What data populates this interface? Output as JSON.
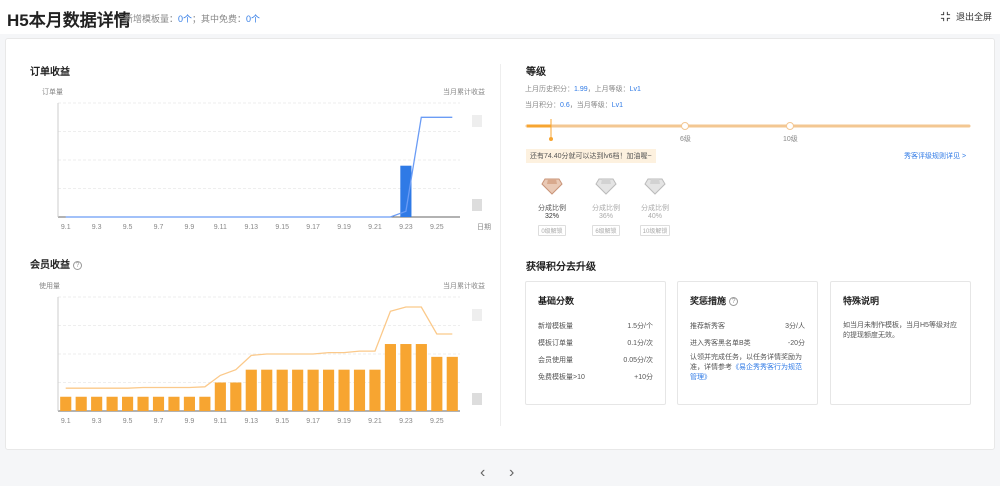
{
  "header": {
    "title": "H5本月数据详情",
    "new_templates_label": "新增模板量：",
    "new_templates_value": "0个",
    "free_label": "；其中免费：",
    "free_value": "0个",
    "exit_fullscreen": "退出全屏"
  },
  "order_revenue": {
    "title": "订单收益",
    "left_axis_label": "订单量",
    "right_axis_label": "当月累计收益",
    "x_axis_label": "日期"
  },
  "member_revenue": {
    "title": "会员收益",
    "left_axis_label": "使用量",
    "right_axis_label": "当月累计收益"
  },
  "level": {
    "title": "等级",
    "last_month_points_label": "上月历史积分：",
    "last_month_points_value": "1.99",
    "last_month_level_label": "，上月等级：",
    "last_month_level_value": "Lv1",
    "current_points_label": "当月积分：",
    "current_points_value": "0.6",
    "current_level_label": "，当月等级：",
    "current_level_value": "Lv1",
    "marker_6": "6级",
    "marker_10": "10级",
    "hint": "还有74.40分就可以达到lv6档！加油喔~",
    "rules_link": "秀客评级规则详见 >",
    "current_progress": 0.6,
    "tiers": [
      {
        "label": "分成比例",
        "pct": "32%",
        "badge": "0级解锁",
        "active": true
      },
      {
        "label": "分成比例",
        "pct": "36%",
        "badge": "6级解锁",
        "active": false
      },
      {
        "label": "分成比例",
        "pct": "40%",
        "badge": "10级解锁",
        "active": false
      }
    ]
  },
  "upgrade": {
    "title": "获得积分去升级",
    "basic": {
      "title": "基础分数",
      "rows": [
        {
          "k": "新增模板量",
          "v": "1.5分/个"
        },
        {
          "k": "模板订单量",
          "v": "0.1分/次"
        },
        {
          "k": "会员使用量",
          "v": "0.05分/次"
        },
        {
          "k": "免费模板量>10",
          "v": "+10分"
        }
      ]
    },
    "reward": {
      "title": "奖惩措施",
      "rows": [
        {
          "k": "推荐新秀客",
          "v": "3分/人"
        },
        {
          "k": "进入秀客黑名单B类",
          "v": "-20分"
        }
      ],
      "note_text": "认领并完成任务，以任务详情奖励为准，详情参考",
      "note_link": "《易企秀秀客行为规范管理》"
    },
    "special": {
      "title": "特殊说明",
      "text": "如当月未制作模板，当月H5等级对应的提现额度无效。"
    }
  },
  "colors": {
    "blue": "#2f7ae6",
    "orange": "#f7a531",
    "line_orange": "#fbc98a"
  },
  "chart_data": [
    {
      "type": "bar",
      "name": "order_revenue",
      "x_tick_labels": [
        "9.1",
        "9.3",
        "9.5",
        "9.7",
        "9.9",
        "9.11",
        "9.13",
        "9.15",
        "9.17",
        "9.19",
        "9.21",
        "9.23",
        "9.25"
      ],
      "x": [
        "9.1",
        "9.2",
        "9.3",
        "9.4",
        "9.5",
        "9.6",
        "9.7",
        "9.8",
        "9.9",
        "9.10",
        "9.11",
        "9.12",
        "9.13",
        "9.14",
        "9.15",
        "9.16",
        "9.17",
        "9.18",
        "9.19",
        "9.20",
        "9.21",
        "9.22",
        "9.23",
        "9.24",
        "9.25",
        "9.26"
      ],
      "bars": [
        0,
        0,
        0,
        0,
        0,
        0,
        0,
        0,
        0,
        0,
        0,
        0,
        0,
        0,
        0,
        0,
        0,
        0,
        0,
        0,
        0,
        0,
        1.8,
        0,
        0,
        0
      ],
      "line": [
        0,
        0,
        0,
        0,
        0,
        0,
        0,
        0,
        0,
        0,
        0,
        0,
        0,
        0,
        0,
        0,
        0,
        0,
        0,
        0,
        0,
        0,
        0.2,
        3.5,
        3.5,
        3.5
      ],
      "ylim": [
        0,
        4
      ],
      "xlabel": "日期",
      "bar_color": "#2f7ae6",
      "line_color": "#6b9cf5"
    },
    {
      "type": "bar",
      "name": "member_revenue",
      "x_tick_labels": [
        "9.1",
        "9.3",
        "9.5",
        "9.7",
        "9.9",
        "9.11",
        "9.13",
        "9.15",
        "9.17",
        "9.19",
        "9.21",
        "9.23",
        "9.25"
      ],
      "x": [
        "9.1",
        "9.2",
        "9.3",
        "9.4",
        "9.5",
        "9.6",
        "9.7",
        "9.8",
        "9.9",
        "9.10",
        "9.11",
        "9.12",
        "9.13",
        "9.14",
        "9.15",
        "9.16",
        "9.17",
        "9.18",
        "9.19",
        "9.20",
        "9.21",
        "9.22",
        "9.23",
        "9.24",
        "9.25",
        "9.26"
      ],
      "bars": [
        1,
        1,
        1,
        1,
        1,
        1,
        1,
        1,
        1,
        1,
        2,
        2,
        2.9,
        2.9,
        2.9,
        2.9,
        2.9,
        2.9,
        2.9,
        2.9,
        2.9,
        4.7,
        4.7,
        4.7,
        3.8,
        3.8
      ],
      "line": [
        1.6,
        1.6,
        1.6,
        1.6,
        1.6,
        1.65,
        1.65,
        1.65,
        1.65,
        1.7,
        2.5,
        2.9,
        3.9,
        4.0,
        4.0,
        4.0,
        4.0,
        4.1,
        4.1,
        4.2,
        4.2,
        7.0,
        7.3,
        7.3,
        5.4,
        5.4
      ],
      "ylim": [
        0,
        8
      ],
      "bar_color": "#f7a531",
      "line_color": "#fbc98a"
    }
  ]
}
